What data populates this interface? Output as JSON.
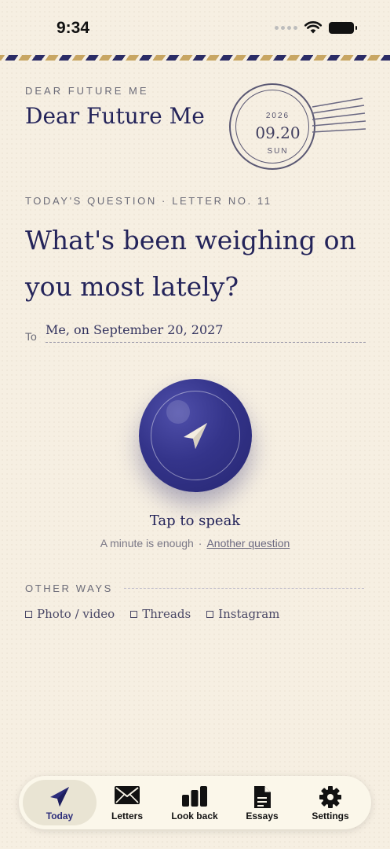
{
  "status_bar": {
    "time": "9:34"
  },
  "header": {
    "brand_small": "DEAR FUTURE ME",
    "brand_title": "Dear Future Me",
    "stamp": {
      "year": "2026",
      "date": "09.20",
      "day": "SUN"
    }
  },
  "question": {
    "label": "TODAY'S QUESTION · LETTER NO. 11",
    "text": "What's been weighing on you most lately?"
  },
  "recipient": {
    "to_label": "To",
    "value": "Me, on September 20, 2027"
  },
  "record": {
    "tap_label": "Tap to speak",
    "hint": "A minute is enough",
    "separator": "·",
    "another_link": "Another question"
  },
  "other_ways": {
    "label": "OTHER WAYS",
    "options": [
      "Photo / video",
      "Threads",
      "Instagram"
    ]
  },
  "tabbar": {
    "tabs": [
      {
        "label": "Today",
        "icon": "paper-plane-icon",
        "active": true
      },
      {
        "label": "Letters",
        "icon": "envelope-icon"
      },
      {
        "label": "Look back",
        "icon": "bar-chart-icon"
      },
      {
        "label": "Essays",
        "icon": "document-icon"
      },
      {
        "label": "Settings",
        "icon": "gear-icon"
      }
    ]
  },
  "colors": {
    "accent": "#2b2c7a",
    "background": "#f6efe2",
    "stripe_gold": "#c8a663",
    "stripe_navy": "#2b2c66"
  }
}
